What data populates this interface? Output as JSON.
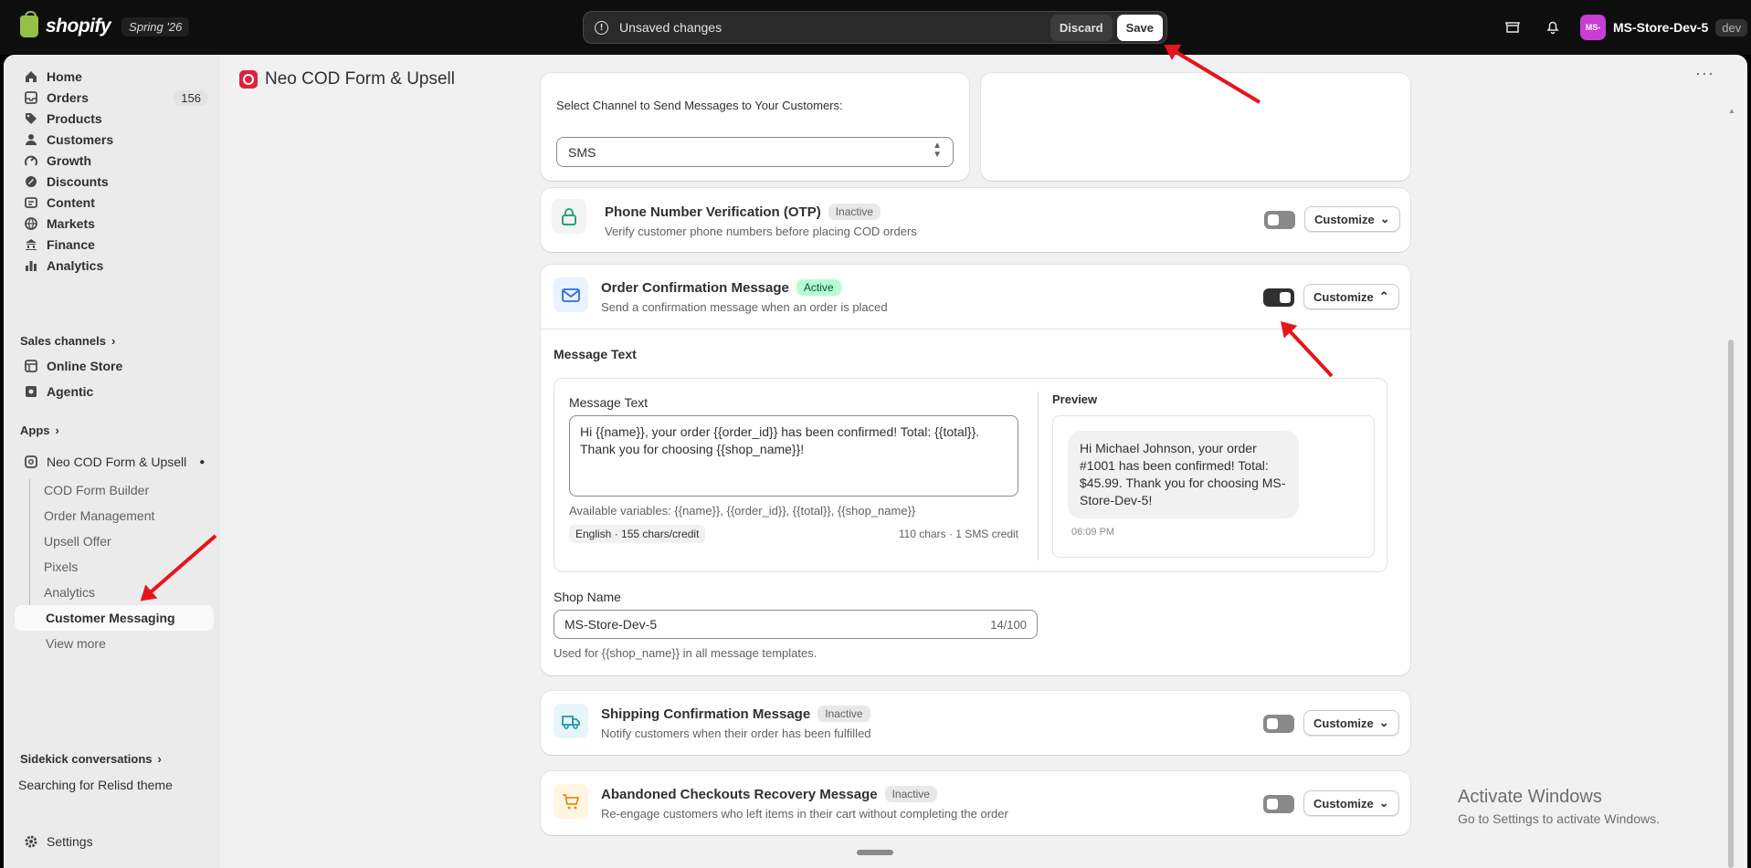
{
  "topbar": {
    "brand": "shopify",
    "edition": "Spring '26",
    "unsaved_text": "Unsaved changes",
    "discard_label": "Discard",
    "save_label": "Save",
    "store_initials": "MS-",
    "store_name": "MS-Store-Dev-5",
    "store_badge": "dev"
  },
  "sidebar": {
    "items": [
      {
        "label": "Home",
        "icon": "home-icon"
      },
      {
        "label": "Orders",
        "icon": "inbox-icon",
        "count": "156"
      },
      {
        "label": "Products",
        "icon": "tag-icon"
      },
      {
        "label": "Customers",
        "icon": "person-icon"
      },
      {
        "label": "Growth",
        "icon": "growth-icon"
      },
      {
        "label": "Discounts",
        "icon": "discount-icon"
      },
      {
        "label": "Content",
        "icon": "content-icon"
      },
      {
        "label": "Markets",
        "icon": "globe-icon"
      },
      {
        "label": "Finance",
        "icon": "bank-icon"
      },
      {
        "label": "Analytics",
        "icon": "bar-chart-icon"
      }
    ],
    "sales_channels_label": "Sales channels",
    "channels": [
      {
        "label": "Online Store",
        "icon": "store-icon"
      },
      {
        "label": "Agentic",
        "icon": "agentic-icon"
      }
    ],
    "apps_label": "Apps",
    "app_name": "Neo COD Form & Upsell",
    "app_subitems": [
      "COD Form Builder",
      "Order Management",
      "Upsell Offer",
      "Pixels",
      "Analytics",
      "Customer Messaging"
    ],
    "view_more": "View more",
    "sidekick_label": "Sidekick conversations",
    "sidekick_item": "Searching for Relisd theme",
    "settings_label": "Settings"
  },
  "page": {
    "title": "Neo COD Form & Upsell",
    "channel_label": "Select Channel to Send Messages to Your Customers:",
    "channel_value": "SMS",
    "features": {
      "otp": {
        "title": "Phone Number Verification (OTP)",
        "status": "Inactive",
        "desc": "Verify customer phone numbers before placing COD orders",
        "enabled": false,
        "button": "Customize"
      },
      "confirm": {
        "title": "Order Confirmation Message",
        "status": "Active",
        "desc": "Send a confirmation message when an order is placed",
        "enabled": true,
        "button": "Customize"
      },
      "shipping": {
        "title": "Shipping Confirmation Message",
        "status": "Inactive",
        "desc": "Notify customers when their order has been fulfilled",
        "enabled": false,
        "button": "Customize"
      },
      "abandoned": {
        "title": "Abandoned Checkouts Recovery Message",
        "status": "Inactive",
        "desc": "Re-engage customers who left items in their cart without completing the order",
        "enabled": false,
        "button": "Customize"
      }
    },
    "message_section_title": "Message Text",
    "message_field_label": "Message Text",
    "message_text": "Hi {{name}}, your order {{order_id}} has been confirmed! Total: {{total}}. Thank you for choosing {{shop_name}}!",
    "variables_hint": "Available variables: {{name}}, {{order_id}}, {{total}}, {{shop_name}}",
    "lang_chip": "English · 155 chars/credit",
    "char_count": "110 chars · 1 SMS credit",
    "preview_label": "Preview",
    "preview_text": "Hi Michael Johnson, your order #1001 has been confirmed! Total: $45.99. Thank you for choosing MS-Store-Dev-5!",
    "preview_time": "06:09 PM",
    "shop_name_label": "Shop Name",
    "shop_name_value": "MS-Store-Dev-5",
    "shop_name_count": "14/100",
    "shop_name_help": "Used for {{shop_name}} in all message templates."
  },
  "watermark": {
    "line1": "Activate Windows",
    "line2": "Go to Settings to activate Windows."
  },
  "colors": {
    "accent_dark": "#303030",
    "active_badge": "#b4fed2",
    "annotation_arrow": "#e8141b"
  }
}
